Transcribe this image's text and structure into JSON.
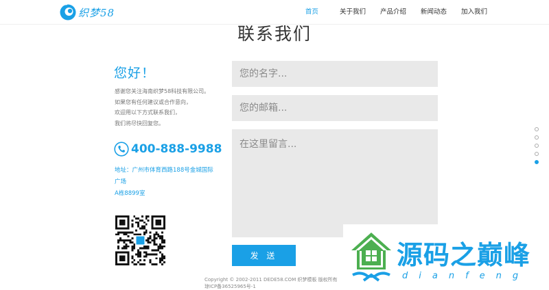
{
  "header": {
    "logo_text": "织梦58",
    "nav": [
      "首页",
      "关于我们",
      "产品介绍",
      "新闻动态",
      "加入我们"
    ]
  },
  "section": {
    "title": "联系我们"
  },
  "contact": {
    "greeting": "您好！",
    "intro": [
      "感谢您关注海南织梦58科技有限公司。",
      "如果您有任何建议或合作意向，",
      "欢迎用以下方式联系我们，",
      "我们将尽快回复您。"
    ],
    "phone": "400-888-9988",
    "address": [
      "地址：广州市体育西路188号金城国际",
      "广场",
      "A栋8899室"
    ]
  },
  "form": {
    "name_placeholder": "您的名字...",
    "email_placeholder": "您的邮箱...",
    "message_placeholder": "在这里留言...",
    "submit_label": "发 送"
  },
  "footer": {
    "lines": [
      "Copyright © 2002-2011 DEDE58.COM 织梦模板 版权所有",
      "琼ICP备36525965号-1"
    ]
  },
  "pager": {
    "count": 5,
    "active_index": 4
  },
  "watermark": {
    "title": "源码之巅峰",
    "subtitle": "dianfeng"
  },
  "colors": {
    "accent": "#1aa0e6",
    "field_bg": "#e9e9e9",
    "watermark_green": "#4caf50"
  }
}
